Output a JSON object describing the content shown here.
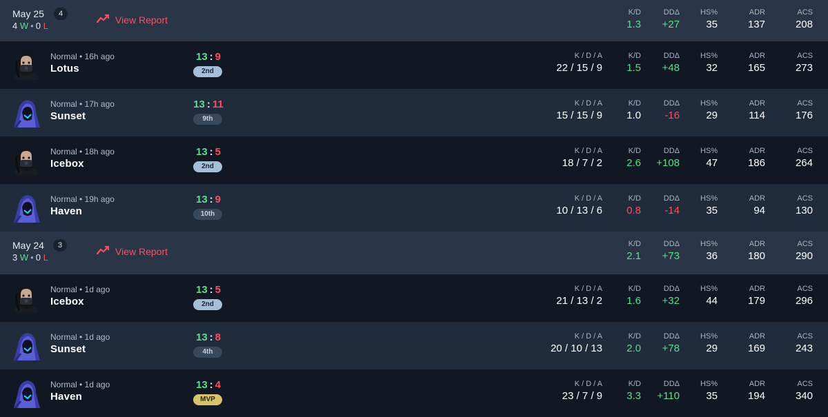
{
  "groups": [
    {
      "date": "May 25",
      "count": "4",
      "wins": "4",
      "w_letter": "W",
      "losses": "0",
      "l_letter": "L",
      "report_label": "View Report",
      "summary": {
        "kd": "1.3",
        "dda": "+27",
        "hs": "35",
        "adr": "137",
        "acs": "208"
      },
      "matches": [
        {
          "mode": "Normal • 16h ago",
          "map": "Lotus",
          "agent": "dark-agent",
          "score_w": "13",
          "score_l": "9",
          "place": "2nd",
          "place_style": "top",
          "kda": "22 / 15 / 9",
          "kd": "1.5",
          "kd_tone": "pos",
          "dda": "+48",
          "dda_tone": "pos",
          "hs": "32",
          "adr": "165",
          "acs": "273"
        },
        {
          "mode": "Normal • 17h ago",
          "map": "Sunset",
          "agent": "hooded-agent",
          "score_w": "13",
          "score_l": "11",
          "place": "9th",
          "place_style": "mid",
          "kda": "15 / 15 / 9",
          "kd": "1.0",
          "kd_tone": "neutral",
          "dda": "-16",
          "dda_tone": "neg",
          "hs": "29",
          "adr": "114",
          "acs": "176"
        },
        {
          "mode": "Normal • 18h ago",
          "map": "Icebox",
          "agent": "dark-agent",
          "score_w": "13",
          "score_l": "5",
          "place": "2nd",
          "place_style": "top",
          "kda": "18 / 7 / 2",
          "kd": "2.6",
          "kd_tone": "pos",
          "dda": "+108",
          "dda_tone": "pos",
          "hs": "47",
          "adr": "186",
          "acs": "264"
        },
        {
          "mode": "Normal • 19h ago",
          "map": "Haven",
          "agent": "hooded-agent",
          "score_w": "13",
          "score_l": "9",
          "place": "10th",
          "place_style": "mid",
          "kda": "10 / 13 / 6",
          "kd": "0.8",
          "kd_tone": "neg",
          "dda": "-14",
          "dda_tone": "neg",
          "hs": "35",
          "adr": "94",
          "acs": "130"
        }
      ]
    },
    {
      "date": "May 24",
      "count": "3",
      "wins": "3",
      "w_letter": "W",
      "losses": "0",
      "l_letter": "L",
      "report_label": "View Report",
      "summary": {
        "kd": "2.1",
        "dda": "+73",
        "hs": "36",
        "adr": "180",
        "acs": "290"
      },
      "matches": [
        {
          "mode": "Normal • 1d ago",
          "map": "Icebox",
          "agent": "dark-agent",
          "score_w": "13",
          "score_l": "5",
          "place": "2nd",
          "place_style": "top",
          "kda": "21 / 13 / 2",
          "kd": "1.6",
          "kd_tone": "pos",
          "dda": "+32",
          "dda_tone": "pos",
          "hs": "44",
          "adr": "179",
          "acs": "296"
        },
        {
          "mode": "Normal • 1d ago",
          "map": "Sunset",
          "agent": "hooded-agent",
          "score_w": "13",
          "score_l": "8",
          "place": "4th",
          "place_style": "mid",
          "kda": "20 / 10 / 13",
          "kd": "2.0",
          "kd_tone": "pos",
          "dda": "+78",
          "dda_tone": "pos",
          "hs": "29",
          "adr": "169",
          "acs": "243"
        },
        {
          "mode": "Normal • 1d ago",
          "map": "Haven",
          "agent": "hooded-agent",
          "score_w": "13",
          "score_l": "4",
          "place": "MVP",
          "place_style": "mvp",
          "kda": "23 / 7 / 9",
          "kd": "3.3",
          "kd_tone": "pos",
          "dda": "+110",
          "dda_tone": "pos",
          "hs": "35",
          "adr": "194",
          "acs": "340"
        }
      ]
    }
  ],
  "labels": {
    "kda": "K / D / A",
    "kd": "K/D",
    "dda": "DDΔ",
    "hs": "HS%",
    "adr": "ADR",
    "acs": "ACS"
  }
}
